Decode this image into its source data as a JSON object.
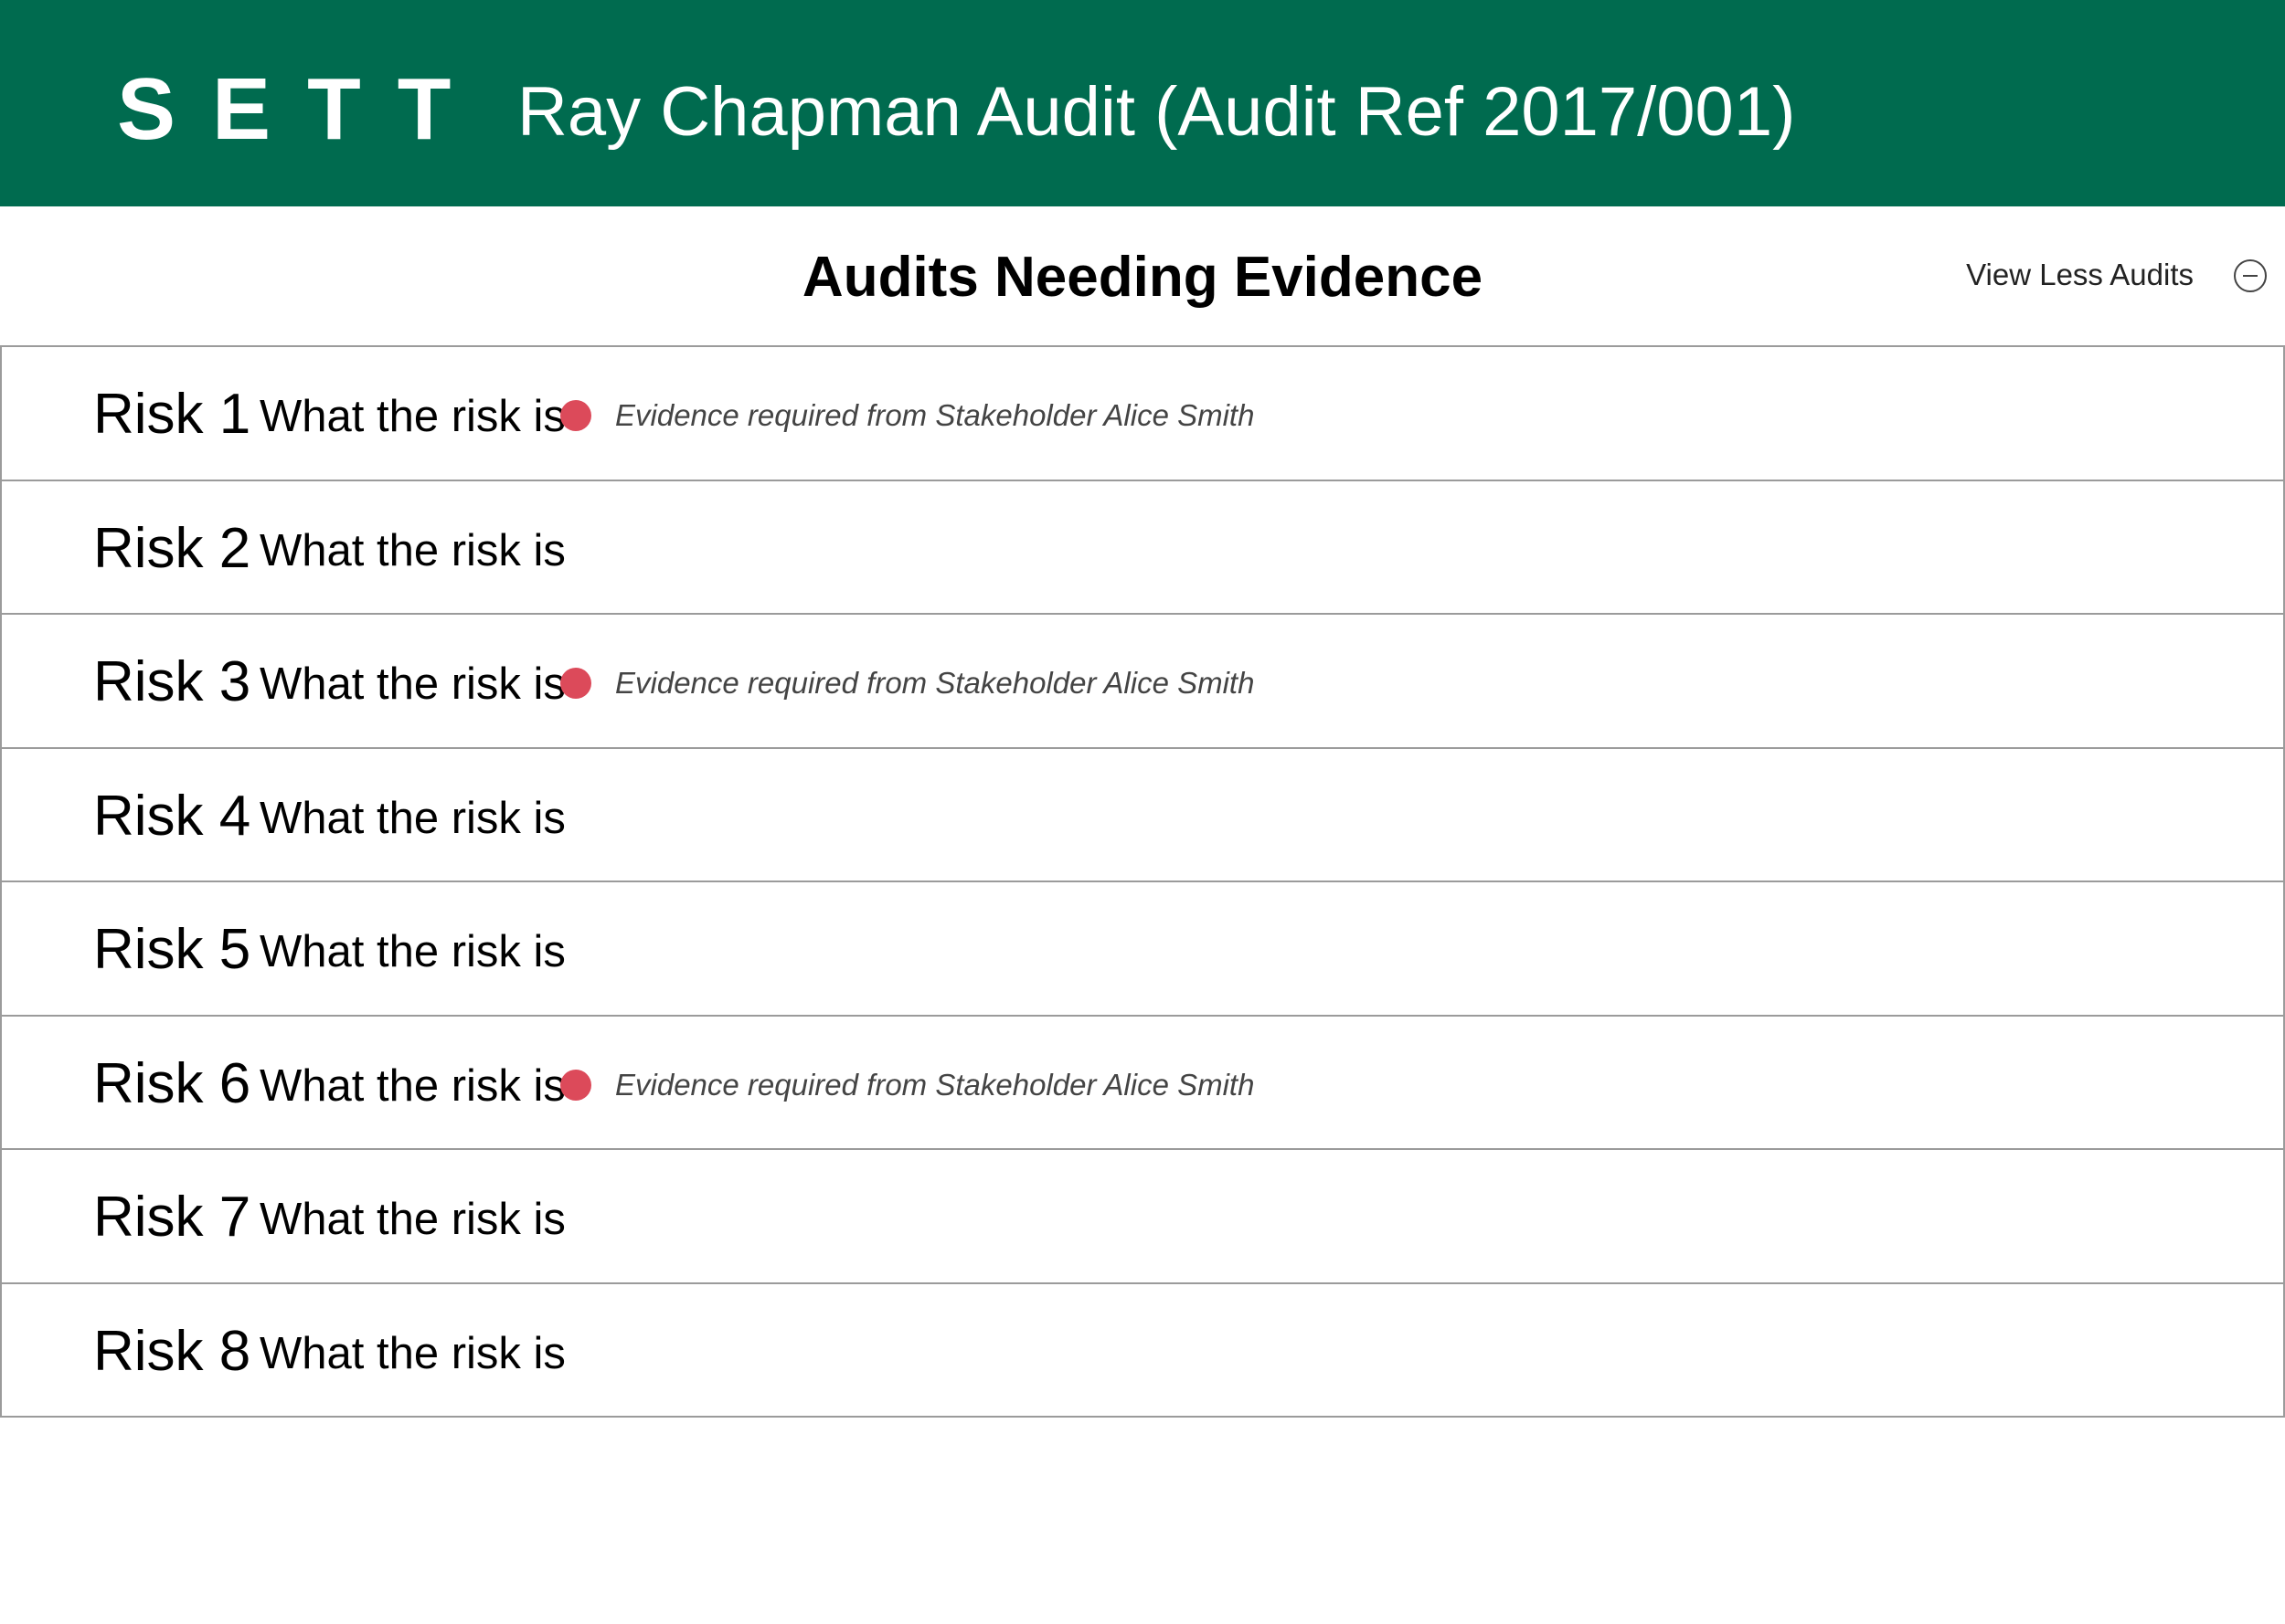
{
  "header": {
    "logo": "SETT",
    "title": "Ray Chapman Audit (Audit Ref 2017/001)",
    "background_color": "#006b4f"
  },
  "section": {
    "title": "Audits Needing Evidence",
    "view_less_label": "View Less Audits",
    "toggle_icon": "minus-circle-icon"
  },
  "status_color": "#dc4a5a",
  "risks": [
    {
      "label": "Risk 1",
      "description": "What the risk is",
      "evidence_note": "Evidence required from Stakeholder Alice Smith"
    },
    {
      "label": "Risk 2",
      "description": "What the risk is",
      "evidence_note": ""
    },
    {
      "label": "Risk 3",
      "description": "What the risk is",
      "evidence_note": "Evidence required from Stakeholder Alice Smith"
    },
    {
      "label": "Risk 4",
      "description": "What the risk is",
      "evidence_note": ""
    },
    {
      "label": "Risk 5",
      "description": "What the risk is",
      "evidence_note": ""
    },
    {
      "label": "Risk 6",
      "description": "What the risk is",
      "evidence_note": "Evidence required from Stakeholder Alice Smith"
    },
    {
      "label": "Risk 7",
      "description": "What the risk is",
      "evidence_note": ""
    },
    {
      "label": "Risk 8",
      "description": "What the risk is",
      "evidence_note": ""
    }
  ]
}
